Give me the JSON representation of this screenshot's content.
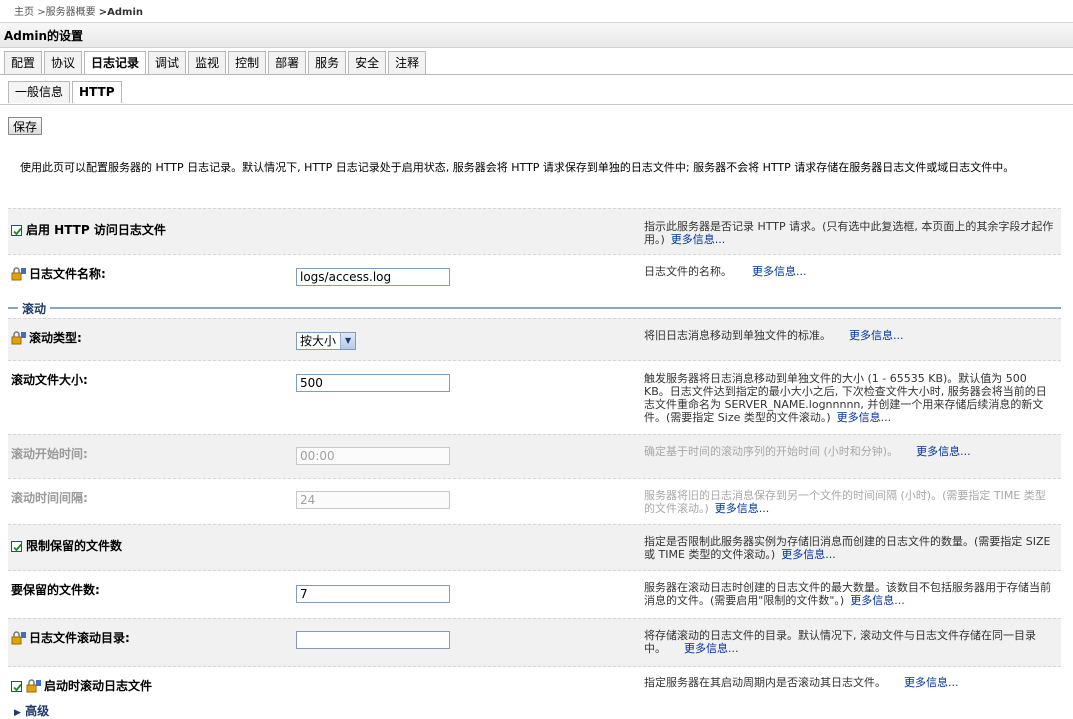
{
  "breadcrumb": {
    "home": "主页",
    "sep1": ">",
    "servers": "服务器概要",
    "sep2": ">",
    "current": "Admin"
  },
  "page": {
    "title": "Admin的设置"
  },
  "tabs": [
    {
      "label": "配置"
    },
    {
      "label": "协议"
    },
    {
      "label": "日志记录",
      "active": true
    },
    {
      "label": "调试"
    },
    {
      "label": "监视"
    },
    {
      "label": "控制"
    },
    {
      "label": "部署"
    },
    {
      "label": "服务"
    },
    {
      "label": "安全"
    },
    {
      "label": "注释"
    }
  ],
  "subtabs": [
    {
      "label": "一般信息"
    },
    {
      "label": "HTTP",
      "active": true
    }
  ],
  "toolbar": {
    "save_label": "保存"
  },
  "intro": "使用此页可以配置服务器的 HTTP 日志记录。默认情况下, HTTP 日志记录处于启用状态, 服务器会将 HTTP 请求保存到单独的日志文件中; 服务器不会将 HTTP 请求存储在服务器日志文件或域日志文件中。",
  "more_info": "更多信息...",
  "fields": {
    "enable_http": {
      "label": "启用 HTTP 访问日志文件",
      "checked": true,
      "help": "指示此服务器是否记录 HTTP 请求。(只有选中此复选框, 本页面上的其余字段才起作用。)"
    },
    "log_file_name": {
      "label": "日志文件名称:",
      "value": "logs/access.log",
      "help": "日志文件的名称。"
    },
    "rotation_section": "滚动",
    "rotation_type": {
      "label": "滚动类型:",
      "value": "按大小",
      "help": "将旧日志消息移动到单独文件的标准。"
    },
    "rotation_size": {
      "label": "滚动文件大小:",
      "value": "500",
      "help": "触发服务器将日志消息移动到单独文件的大小 (1 - 65535 KB)。默认值为 500 KB。日志文件达到指定的最小大小之后, 下次检查文件大小时, 服务器会将当前的日志文件重命名为 SERVER_NAME.lognnnnn, 并创建一个用来存储后续消息的新文件。(需要指定 Size 类型的文件滚动。)"
    },
    "rotation_start": {
      "label": "滚动开始时间:",
      "value": "00:00",
      "help": "确定基于时间的滚动序列的开始时间 (小时和分钟)。"
    },
    "rotation_interval": {
      "label": "滚动时间间隔:",
      "value": "24",
      "help": "服务器将旧的日志消息保存到另一个文件的时间间隔 (小时)。(需要指定 TIME 类型的文件滚动。)"
    },
    "limit_files": {
      "label": "限制保留的文件数",
      "checked": true,
      "help": "指定是否限制此服务器实例为存储旧消息而创建的日志文件的数量。(需要指定 SIZE 或 TIME 类型的文件滚动。)"
    },
    "files_to_retain": {
      "label": "要保留的文件数:",
      "value": "7",
      "help": "服务器在滚动日志时创建的日志文件的最大数量。该数目不包括服务器用于存储当前消息的文件。(需要启用\"限制的文件数\"。)"
    },
    "rotation_dir": {
      "label": "日志文件滚动目录:",
      "value": "",
      "help": "将存储滚动的日志文件的目录。默认情况下, 滚动文件与日志文件存储在同一目录中。"
    },
    "rotate_on_startup": {
      "label": "启动时滚动日志文件",
      "checked": true,
      "help": "指定服务器在其启动周期内是否滚动其日志文件。"
    }
  },
  "advanced": "高级"
}
